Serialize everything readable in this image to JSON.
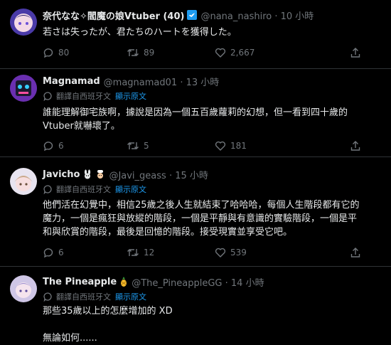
{
  "colors": {
    "background": "#000000",
    "text": "#e7e9ea",
    "muted": "#71767b",
    "accent": "#1d9bf0",
    "divider": "#2f3336"
  },
  "posts": [
    {
      "name": "奈代なな✧閻魔の娘Vtuber (40)",
      "badge_icon": "twitter-verified-badge-icon",
      "handle_time": "@nana_nashiro · 10 小時",
      "text": "若さは失ったが、君たちのハートを獲得した。",
      "reply_count": "80",
      "retweet_count": "89",
      "like_count": "2,667"
    },
    {
      "name": "Magnamad",
      "handle_time": "@magnamad01 · 13 小時",
      "translate_label": "翻譯自西班牙文",
      "show_original": "顯示原文",
      "text": "誰能理解御宅族啊，據說是因為一個五百歲蘿莉的幻想，但一看到四十歲的\nVtuber就嚇壞了。",
      "reply_count": "6",
      "retweet_count": "5",
      "like_count": "181"
    },
    {
      "name": "Javicho",
      "handle_time": "@Javi_geass · 15 小時",
      "translate_label": "翻譯自西班牙文",
      "show_original": "顯示原文",
      "text": "他們活在幻覺中，相信25歲之後人生就結束了哈哈哈，每個人生階段都有它的\n魔力，一個是瘋狂與放縱的階段，一個是平靜與有意識的實驗階段，一個是平\n和與欣賞的階段，最後是回憶的階段。接受現實並享受它吧。",
      "reply_count": "6",
      "retweet_count": "12",
      "like_count": "539"
    },
    {
      "name": "The Pineapple",
      "handle_time": "@The_PineappleGG · 14 小時",
      "translate_label": "翻譯自西班牙文",
      "show_original": "顯示原文",
      "text": "那些35歲以上的怎麼增加的 XD\n\n無論如何......"
    }
  ]
}
